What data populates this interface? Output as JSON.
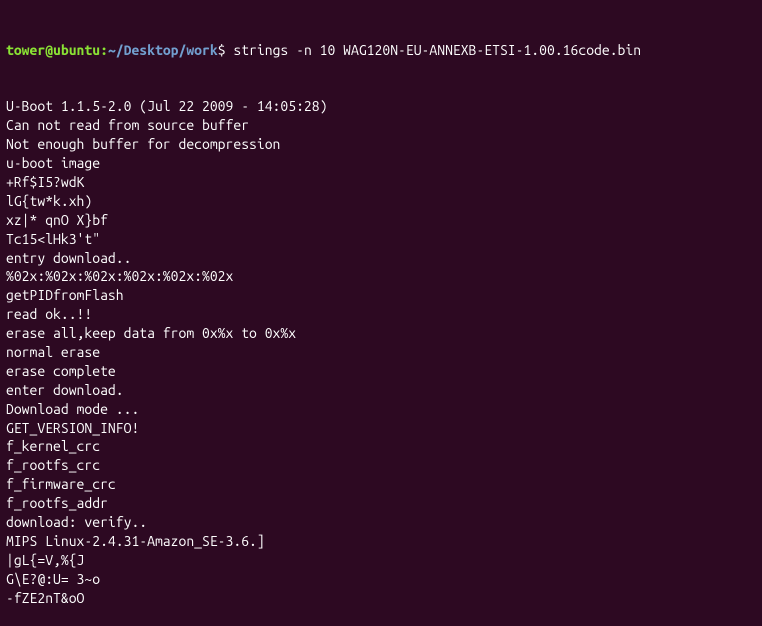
{
  "prompt": {
    "user": "tower@ubuntu",
    "separator": ":",
    "path": "~/Desktop/work",
    "suffix": "$ "
  },
  "command": "strings -n 10 WAG120N-EU-ANNEXB-ETSI-1.00.16code.bin",
  "output": [
    "U-Boot 1.1.5-2.0 (Jul 22 2009 - 14:05:28)",
    "Can not read from source buffer",
    "Not enough buffer for decompression",
    "u-boot image",
    "+Rf$I5?wdK",
    "lG{tw*k.xh)",
    "xz|* qnO X}bf",
    "Tc15<lHk3't\"",
    "entry download..",
    "%02x:%02x:%02x:%02x:%02x:%02x",
    "getPIDfromFlash",
    "read ok..!!",
    "erase all,keep data from 0x%x to 0x%x",
    "normal erase",
    "erase complete",
    "enter download.",
    "Download mode ...",
    "GET_VERSION_INFO!",
    "f_kernel_crc",
    "f_rootfs_crc",
    "f_firmware_crc",
    "f_rootfs_addr",
    "download: verify..",
    "MIPS Linux-2.4.31-Amazon_SE-3.6.]",
    "|gL{=V,%{J",
    "G\\E?@:U= 3~o",
    "-fZE2nT&oO"
  ]
}
